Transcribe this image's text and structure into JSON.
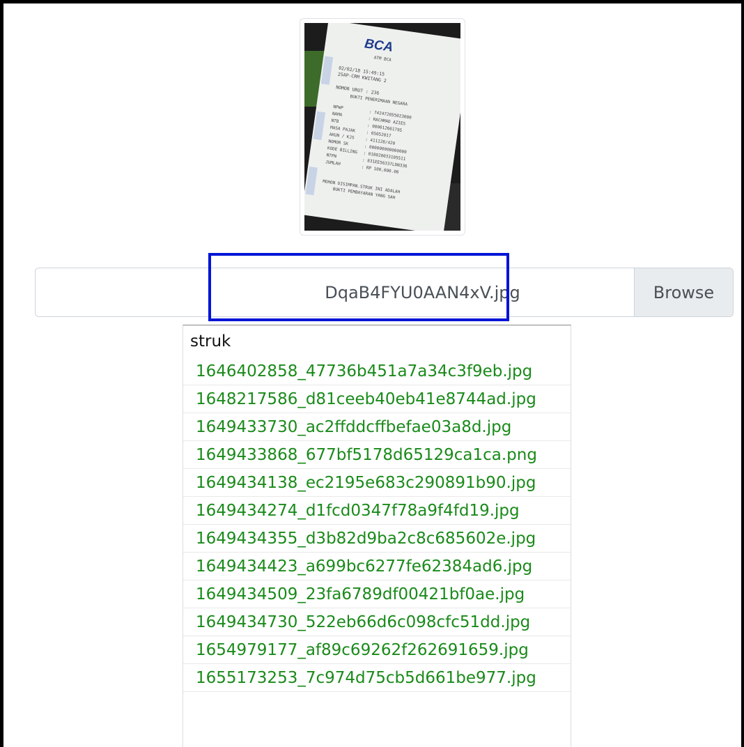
{
  "thumbnail": {
    "bank_name": "BCA",
    "atm_label": "ATM BCA",
    "date_time": "02/02/18  15:49:15",
    "location": "2SAP-CRM KWITANG 2",
    "nomor_urut": "NOMOR URUT  : 236",
    "heading": "BUKTI PENERIMAAN NEGARA",
    "fields": [
      {
        "label": "NPWP",
        "value": ": 742472855023000"
      },
      {
        "label": "NAMA",
        "value": ": RACHMAD AZIES"
      },
      {
        "label": "NTB",
        "value": ": 000012661795"
      },
      {
        "label": "MASA PAJAK",
        "value": ": 05052017"
      },
      {
        "label": "AKUN / KJS",
        "value": ": 411128/420"
      },
      {
        "label": "NOMOR SK",
        "value": ": 000000000000000"
      },
      {
        "label": "KODE BILLING",
        "value": ": 018020033105511"
      },
      {
        "label": "NTPN",
        "value": ": 831EE56337LDN336"
      },
      {
        "label": "JUMLAH",
        "value": ": RP        100,000.00"
      }
    ],
    "footer_line1": "MOHON DISIMPAN.STRUK INI ADALAH",
    "footer_line2": "BUKTI PEMBAYARAN YANG SAH"
  },
  "file_input": {
    "file_name": "DqaB4FYU0AAN4xV.jpg",
    "browse_label": "Browse"
  },
  "dropdown": {
    "folder": "struk",
    "files": [
      "1646402858_47736b451a7a34c3f9eb.jpg",
      "1648217586_d81ceeb40eb41e8744ad.jpg",
      "1649433730_ac2ffddcffbefae03a8d.jpg",
      "1649433868_677bf5178d65129ca1ca.png",
      "1649434138_ec2195e683c290891b90.jpg",
      "1649434274_d1fcd0347f78a9f4fd19.jpg",
      "1649434355_d3b82d9ba2c8c685602e.jpg",
      "1649434423_a699bc6277fe62384ad6.jpg",
      "1649434509_23fa6789df00421bf0ae.jpg",
      "1649434730_522eb66d6c098cfc51dd.jpg",
      "1654979177_af89c69262f262691659.jpg",
      "1655173253_7c974d75cb5d661be977.jpg"
    ]
  },
  "colors": {
    "highlight_box": "#0015d6",
    "file_link": "#1a8a1a",
    "browse_bg": "#e9ecef"
  }
}
